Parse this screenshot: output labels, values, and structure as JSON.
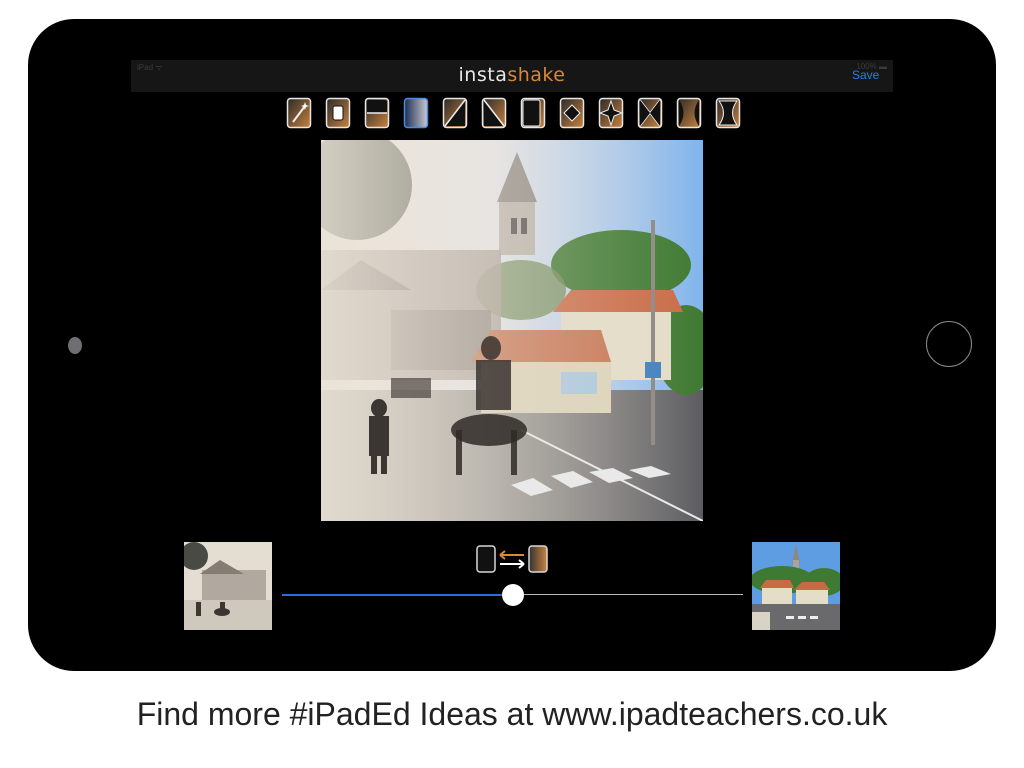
{
  "status_bar": {
    "left_text": "iPad ᯤ",
    "right_text": "100% ▬"
  },
  "app": {
    "title_part1": "insta",
    "title_part2": "shake",
    "save_label": "Save",
    "title_color": "#e8e8e8",
    "accent_color": "#d9883a",
    "link_color": "#2f7fe0"
  },
  "toolbar": {
    "tools": [
      {
        "name": "magic-wand-icon",
        "selected": false
      },
      {
        "name": "center-box-transition-icon",
        "selected": false
      },
      {
        "name": "horizontal-split-transition-icon",
        "selected": false
      },
      {
        "name": "vertical-gradient-transition-icon",
        "selected": true
      },
      {
        "name": "diagonal-left-transition-icon",
        "selected": false
      },
      {
        "name": "diagonal-right-transition-icon",
        "selected": false
      },
      {
        "name": "left-edge-transition-icon",
        "selected": false
      },
      {
        "name": "diamond-transition-icon",
        "selected": false
      },
      {
        "name": "star-transition-icon",
        "selected": false
      },
      {
        "name": "cross-diagonal-transition-icon",
        "selected": false
      },
      {
        "name": "curved-sides-transition-icon",
        "selected": false
      },
      {
        "name": "hourglass-transition-icon",
        "selected": false
      }
    ]
  },
  "blend": {
    "swap_icon": "swap-images-icon",
    "slider_value": 0.5,
    "slider_fill_color": "#2a6fd6"
  },
  "caption": "Find more #iPadEd Ideas at www.ipadteachers.co.uk"
}
